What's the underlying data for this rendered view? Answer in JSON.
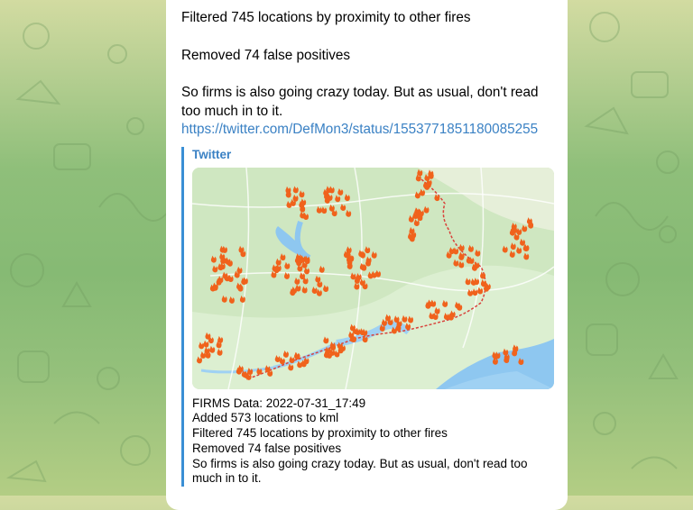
{
  "message": {
    "line1": "Filtered 745 locations by proximity to other fires",
    "line2": "Removed 74 false positives",
    "line3": "So firms is also going crazy today. But as usual, don't read too much in to it.",
    "link": "https://twitter.com/DefMon3/status/1553771851180085255"
  },
  "preview": {
    "site_name": "Twitter",
    "image_alt": "fire map",
    "description_lines": [
      "FIRMS Data: 2022-07-31_17:49",
      "Added 573 locations to kml",
      "Filtered 745 locations by proximity to other fires",
      "Removed 74 false positives",
      "So firms is also going crazy today. But as usual, don't read too",
      "much in to it."
    ]
  },
  "colors": {
    "link": "#3a81c4",
    "accent_bar": "#3a8fd5",
    "fire": "#f0621c",
    "front_line": "#d9413a"
  },
  "icons": [
    "fire-icon"
  ]
}
